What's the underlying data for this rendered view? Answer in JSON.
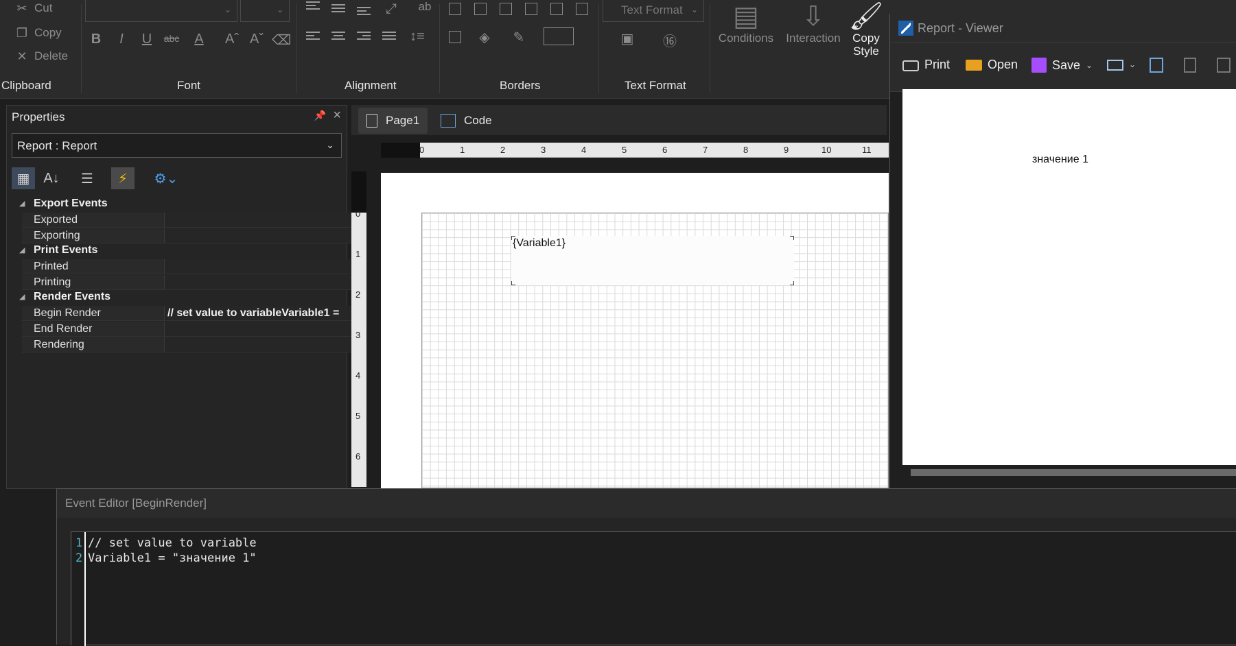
{
  "ribbon": {
    "clipboard": {
      "cut": "Cut",
      "copy": "Copy",
      "delete": "Delete",
      "group": "Clipboard"
    },
    "font": {
      "group": "Font"
    },
    "alignment": {
      "group": "Alignment"
    },
    "borders": {
      "group": "Borders"
    },
    "text_format": {
      "combo": "Text Format",
      "group": "Text Format"
    },
    "conditions": "Conditions",
    "interaction": "Interaction",
    "copy_style_line1": "Copy",
    "copy_style_line2": "Style"
  },
  "properties": {
    "title": "Properties",
    "selected": "Report : Report",
    "categories": [
      {
        "name": "Export  Events",
        "items": [
          {
            "name": "Exported",
            "value": ""
          },
          {
            "name": "Exporting",
            "value": ""
          }
        ]
      },
      {
        "name": "Print  Events",
        "items": [
          {
            "name": "Printed",
            "value": ""
          },
          {
            "name": "Printing",
            "value": ""
          }
        ]
      },
      {
        "name": "Render  Events",
        "items": [
          {
            "name": "Begin Render",
            "value": "// set value to variableVariable1 ="
          },
          {
            "name": "End Render",
            "value": ""
          },
          {
            "name": "Rendering",
            "value": ""
          }
        ]
      }
    ]
  },
  "designer": {
    "tabs": [
      {
        "label": "Page1"
      },
      {
        "label": "Code"
      }
    ],
    "ruler_h": [
      "0",
      "1",
      "2",
      "3",
      "4",
      "5",
      "6",
      "7",
      "8",
      "9",
      "10",
      "11"
    ],
    "ruler_v": [
      "0",
      "1",
      "2",
      "3",
      "4",
      "5",
      "6"
    ],
    "textbox": "{Variable1}"
  },
  "viewer": {
    "title": "Report - Viewer",
    "print": "Print",
    "open": "Open",
    "save": "Save",
    "content": "значение 1"
  },
  "editor": {
    "title": "Event Editor [BeginRender]",
    "lines": [
      {
        "num": "1",
        "text": "// set value to variable"
      },
      {
        "num": "2",
        "text": "Variable1 = \"значение 1\""
      }
    ]
  },
  "colors": {
    "accent_bolt": "#f2c200",
    "code_linenum": "#4fb0c6",
    "save_icon": "#a64dff",
    "open_icon": "#e8a020"
  }
}
